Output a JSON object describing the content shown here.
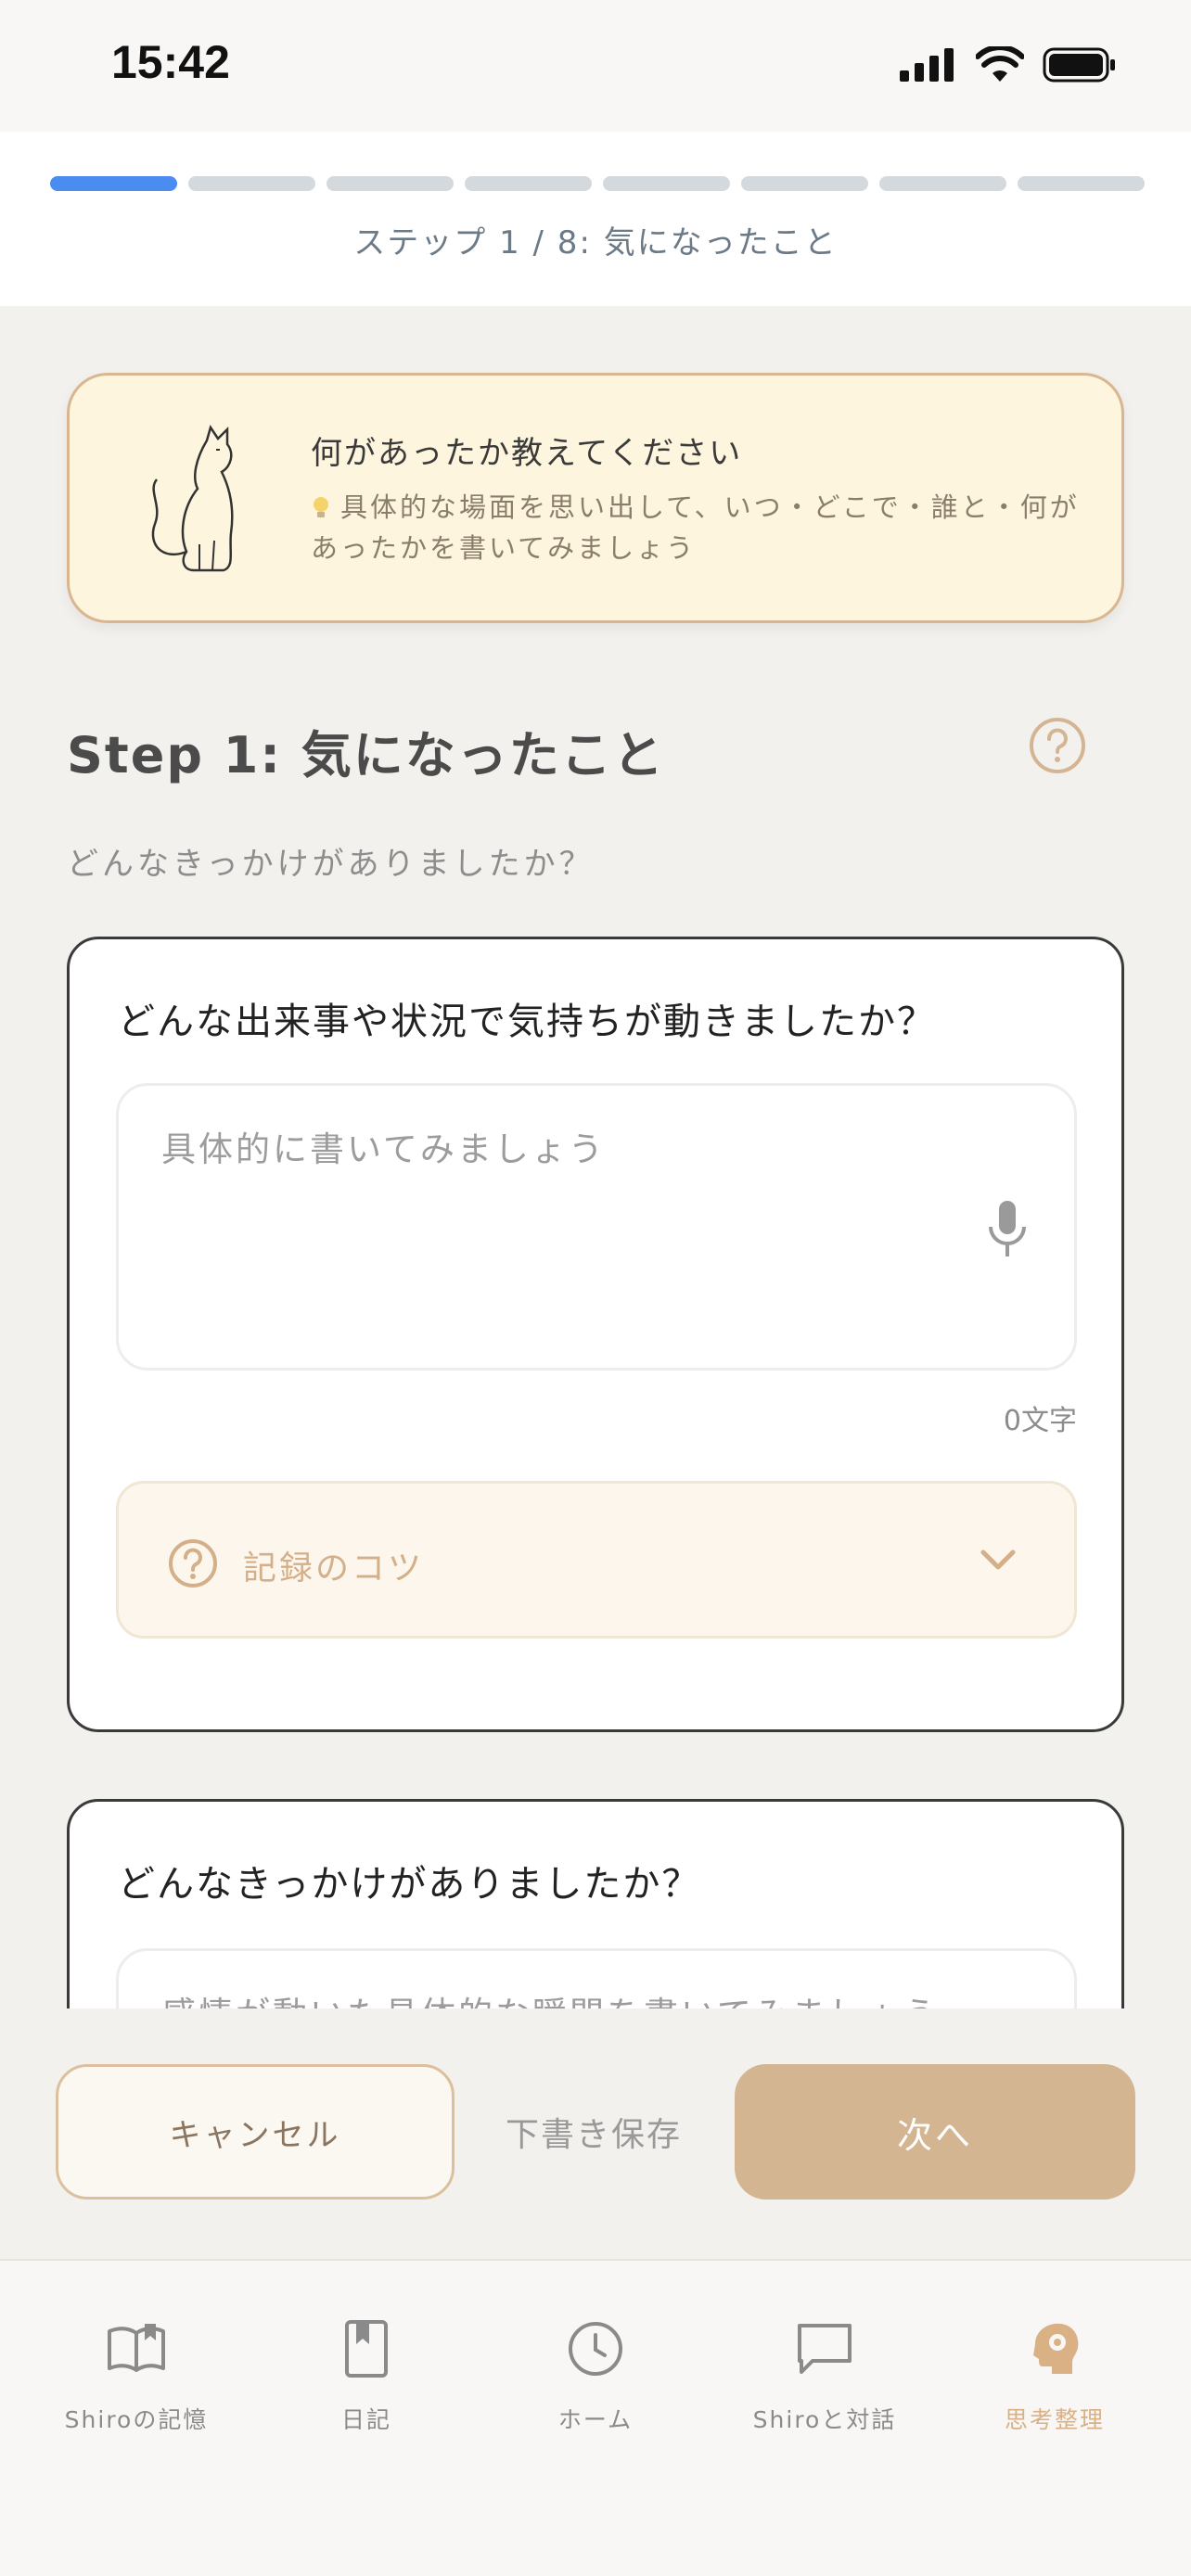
{
  "status_bar": {
    "time": "15:42"
  },
  "progress": {
    "total_steps": 8,
    "current_step": 1,
    "label": "ステップ 1 / 8: 気になったこと"
  },
  "hint": {
    "title": "何があったか教えてください",
    "body": "具体的な場面を思い出して、いつ・どこで・誰と・何があったかを書いてみましょう"
  },
  "step": {
    "heading": "Step 1: 気になったこと",
    "subtitle": "どんなきっかけがありましたか？"
  },
  "question1": {
    "title": "どんな出来事や状況で気持ちが動きましたか？",
    "placeholder": "具体的に書いてみましょう",
    "char_count": "0文字",
    "tips_label": "記録のコツ"
  },
  "question2": {
    "title": "どんなきっかけがありましたか？",
    "placeholder": "感情が動いた具体的な瞬間を書いてみましょう"
  },
  "actions": {
    "cancel": "キャンセル",
    "draft": "下書き保存",
    "next": "次へ"
  },
  "tabs": [
    {
      "label": "Shiroの記憶",
      "icon": "book-open-icon"
    },
    {
      "label": "日記",
      "icon": "bookmark-book-icon"
    },
    {
      "label": "ホーム",
      "icon": "clock-icon"
    },
    {
      "label": "Shiroと対話",
      "icon": "chat-bubble-icon"
    },
    {
      "label": "思考整理",
      "icon": "brain-gear-icon",
      "active": true
    }
  ],
  "colors": {
    "accent": "#d4b592",
    "progress_active": "#4a8cf0",
    "hint_bg": "#fdf5dd"
  }
}
